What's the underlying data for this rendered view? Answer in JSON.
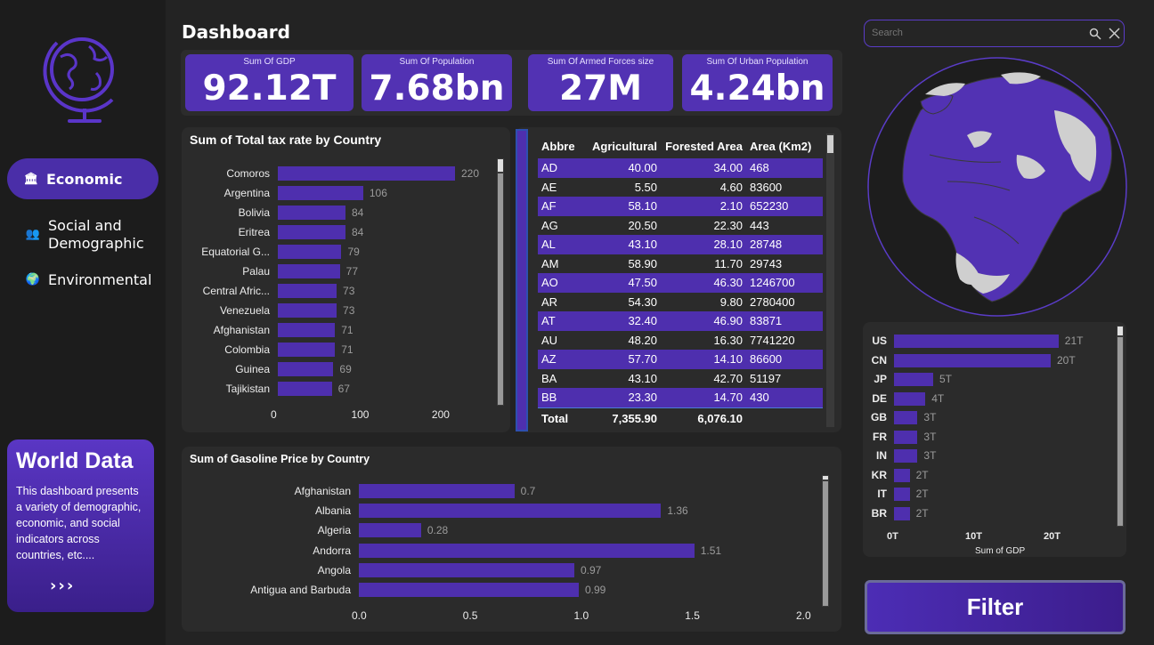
{
  "sidebar": {
    "nav": [
      {
        "label": "Economic",
        "icon": "bank-icon"
      },
      {
        "label": "Social and Demographic",
        "icon": "people-icon"
      },
      {
        "label": "Environmental",
        "icon": "earth-icon"
      }
    ],
    "card": {
      "title": "World Data",
      "text": "This dashboard presents a variety of demographic, economic, and social indicators across countries, etc....",
      "arrows": "›››"
    }
  },
  "header": {
    "title": "Dashboard"
  },
  "kpis": [
    {
      "label": "Sum Of GDP",
      "value": "92.12T"
    },
    {
      "label": "Sum Of Population",
      "value": "7.68bn"
    },
    {
      "label": "Sum Of Armed Forces size",
      "value": "27M"
    },
    {
      "label": "Sum Of Urban Population",
      "value": "4.24bn"
    }
  ],
  "search": {
    "placeholder": "Search"
  },
  "filter_label": "Filter",
  "table": {
    "headers": [
      "Abbre",
      "Agricultural",
      "Forested Area",
      "Area (Km2)"
    ],
    "rows": [
      [
        "AD",
        "40.00",
        "34.00",
        "468"
      ],
      [
        "AE",
        "5.50",
        "4.60",
        "83600"
      ],
      [
        "AF",
        "58.10",
        "2.10",
        "652230"
      ],
      [
        "AG",
        "20.50",
        "22.30",
        "443"
      ],
      [
        "AL",
        "43.10",
        "28.10",
        "28748"
      ],
      [
        "AM",
        "58.90",
        "11.70",
        "29743"
      ],
      [
        "AO",
        "47.50",
        "46.30",
        "1246700"
      ],
      [
        "AR",
        "54.30",
        "9.80",
        "2780400"
      ],
      [
        "AT",
        "32.40",
        "46.90",
        "83871"
      ],
      [
        "AU",
        "48.20",
        "16.30",
        "7741220"
      ],
      [
        "AZ",
        "57.70",
        "14.10",
        "86600"
      ],
      [
        "BA",
        "43.10",
        "42.70",
        "51197"
      ],
      [
        "BB",
        "23.30",
        "14.70",
        "430"
      ]
    ],
    "total": [
      "Total",
      "7,355.90",
      "6,076.10",
      ""
    ]
  },
  "chart_data": [
    {
      "type": "bar",
      "title": "Sum of Total tax rate by Country",
      "categories": [
        "Comoros",
        "Argentina",
        "Bolivia",
        "Eritrea",
        "Equatorial G...",
        "Palau",
        "Central Afric...",
        "Venezuela",
        "Afghanistan",
        "Colombia",
        "Guinea",
        "Tajikistan"
      ],
      "values": [
        220,
        106,
        84,
        84,
        79,
        77,
        73,
        73,
        71,
        71,
        69,
        67
      ],
      "value_labels": [
        "220",
        "106",
        "84",
        "84",
        "79",
        "77",
        "73",
        "73",
        "71",
        "71",
        "69",
        "67"
      ],
      "ticks": [
        "0",
        "100",
        "200"
      ],
      "xlim": [
        0,
        230
      ],
      "color": "#4e2fae"
    },
    {
      "type": "bar",
      "title": "Sum of Gasoline Price by Country",
      "categories": [
        "Afghanistan",
        "Albania",
        "Algeria",
        "Andorra",
        "Angola",
        "Antigua and Barbuda"
      ],
      "values": [
        0.7,
        1.36,
        0.28,
        1.51,
        0.97,
        0.99
      ],
      "value_labels": [
        "0.7",
        "1.36",
        "0.28",
        "1.51",
        "0.97",
        "0.99"
      ],
      "ticks": [
        "0.0",
        "0.5",
        "1.0",
        "1.5",
        "2.0"
      ],
      "xlim": [
        0,
        2.0
      ],
      "color": "#4e2fae"
    },
    {
      "type": "bar",
      "xlabel": "Sum of GDP",
      "categories": [
        "US",
        "CN",
        "JP",
        "DE",
        "GB",
        "FR",
        "IN",
        "KR",
        "IT",
        "BR"
      ],
      "values": [
        21,
        20,
        5,
        4,
        3,
        3,
        3,
        2,
        2,
        2
      ],
      "value_labels": [
        "21T",
        "20T",
        "5T",
        "4T",
        "3T",
        "3T",
        "3T",
        "2T",
        "2T",
        "2T"
      ],
      "ticks": [
        "0T",
        "10T",
        "20T"
      ],
      "xlim": [
        0,
        25
      ],
      "color": "#4e2fae"
    }
  ]
}
